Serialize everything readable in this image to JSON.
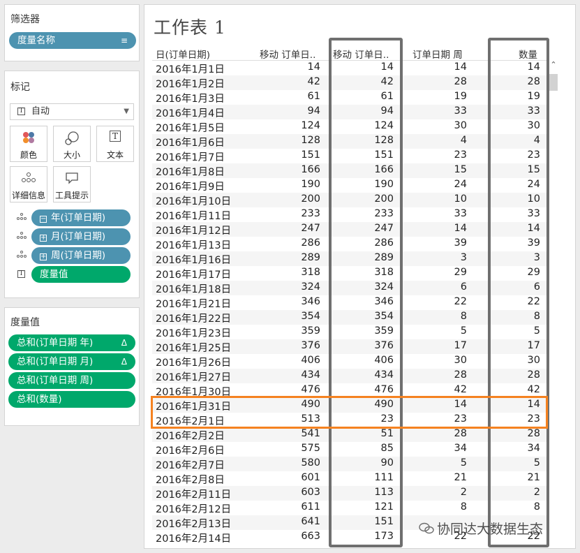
{
  "filters": {
    "title": "筛选器",
    "pills": [
      {
        "label": "度量名称",
        "icon": "sort-desc-icon"
      }
    ]
  },
  "marks": {
    "title": "标记",
    "mark_type": "自动",
    "cards": {
      "color": "颜色",
      "size": "大小",
      "text": "文本",
      "detail": "详细信息",
      "tooltip": "工具提示"
    },
    "fields": [
      {
        "label": "年(订单日期)",
        "expand": "⊟",
        "type": "detail"
      },
      {
        "label": "月(订单日期)",
        "expand": "⊞",
        "type": "detail"
      },
      {
        "label": "周(订单日期)",
        "expand": "⊞",
        "type": "detail"
      },
      {
        "label": "度量值",
        "type": "text"
      }
    ]
  },
  "measure_values": {
    "title": "度量值",
    "pills": [
      {
        "label": "总和(订单日期 年)",
        "delta": "Δ"
      },
      {
        "label": "总和(订单日期 月)",
        "delta": "Δ"
      },
      {
        "label": "总和(订单日期 周)",
        "delta": ""
      },
      {
        "label": "总和(数量)",
        "delta": ""
      }
    ]
  },
  "worksheet": {
    "title": "工作表 1",
    "columns": [
      "日(订单日期)",
      "移动 订单日..",
      "移动 订单日..",
      "订单日期 周",
      "数量"
    ],
    "rows": [
      [
        "2016年1月1日",
        "14",
        "14",
        "14",
        "14"
      ],
      [
        "2016年1月2日",
        "42",
        "42",
        "28",
        "28"
      ],
      [
        "2016年1月3日",
        "61",
        "61",
        "19",
        "19"
      ],
      [
        "2016年1月4日",
        "94",
        "94",
        "33",
        "33"
      ],
      [
        "2016年1月5日",
        "124",
        "124",
        "30",
        "30"
      ],
      [
        "2016年1月6日",
        "128",
        "128",
        "4",
        "4"
      ],
      [
        "2016年1月7日",
        "151",
        "151",
        "23",
        "23"
      ],
      [
        "2016年1月8日",
        "166",
        "166",
        "15",
        "15"
      ],
      [
        "2016年1月9日",
        "190",
        "190",
        "24",
        "24"
      ],
      [
        "2016年1月10日",
        "200",
        "200",
        "10",
        "10"
      ],
      [
        "2016年1月11日",
        "233",
        "233",
        "33",
        "33"
      ],
      [
        "2016年1月12日",
        "247",
        "247",
        "14",
        "14"
      ],
      [
        "2016年1月13日",
        "286",
        "286",
        "39",
        "39"
      ],
      [
        "2016年1月16日",
        "289",
        "289",
        "3",
        "3"
      ],
      [
        "2016年1月17日",
        "318",
        "318",
        "29",
        "29"
      ],
      [
        "2016年1月18日",
        "324",
        "324",
        "6",
        "6"
      ],
      [
        "2016年1月21日",
        "346",
        "346",
        "22",
        "22"
      ],
      [
        "2016年1月22日",
        "354",
        "354",
        "8",
        "8"
      ],
      [
        "2016年1月23日",
        "359",
        "359",
        "5",
        "5"
      ],
      [
        "2016年1月25日",
        "376",
        "376",
        "17",
        "17"
      ],
      [
        "2016年1月26日",
        "406",
        "406",
        "30",
        "30"
      ],
      [
        "2016年1月27日",
        "434",
        "434",
        "28",
        "28"
      ],
      [
        "2016年1月30日",
        "476",
        "476",
        "42",
        "42"
      ],
      [
        "2016年1月31日",
        "490",
        "490",
        "14",
        "14"
      ],
      [
        "2016年2月1日",
        "513",
        "23",
        "23",
        "23"
      ],
      [
        "2016年2月2日",
        "541",
        "51",
        "28",
        "28"
      ],
      [
        "2016年2月6日",
        "575",
        "85",
        "34",
        "34"
      ],
      [
        "2016年2月7日",
        "580",
        "90",
        "5",
        "5"
      ],
      [
        "2016年2月8日",
        "601",
        "111",
        "21",
        "21"
      ],
      [
        "2016年2月11日",
        "603",
        "113",
        "2",
        "2"
      ],
      [
        "2016年2月12日",
        "611",
        "121",
        "8",
        "8"
      ],
      [
        "2016年2月13日",
        "641",
        "151",
        "",
        ""
      ],
      [
        "2016年2月14日",
        "663",
        "173",
        "22",
        "22"
      ]
    ]
  },
  "watermark": "协同达大数据生态",
  "colors": {
    "pill_blue": "#4d93b0",
    "pill_green": "#00a86b",
    "highlight_orange": "#f58220",
    "highlight_gray": "#6f6f6f"
  }
}
